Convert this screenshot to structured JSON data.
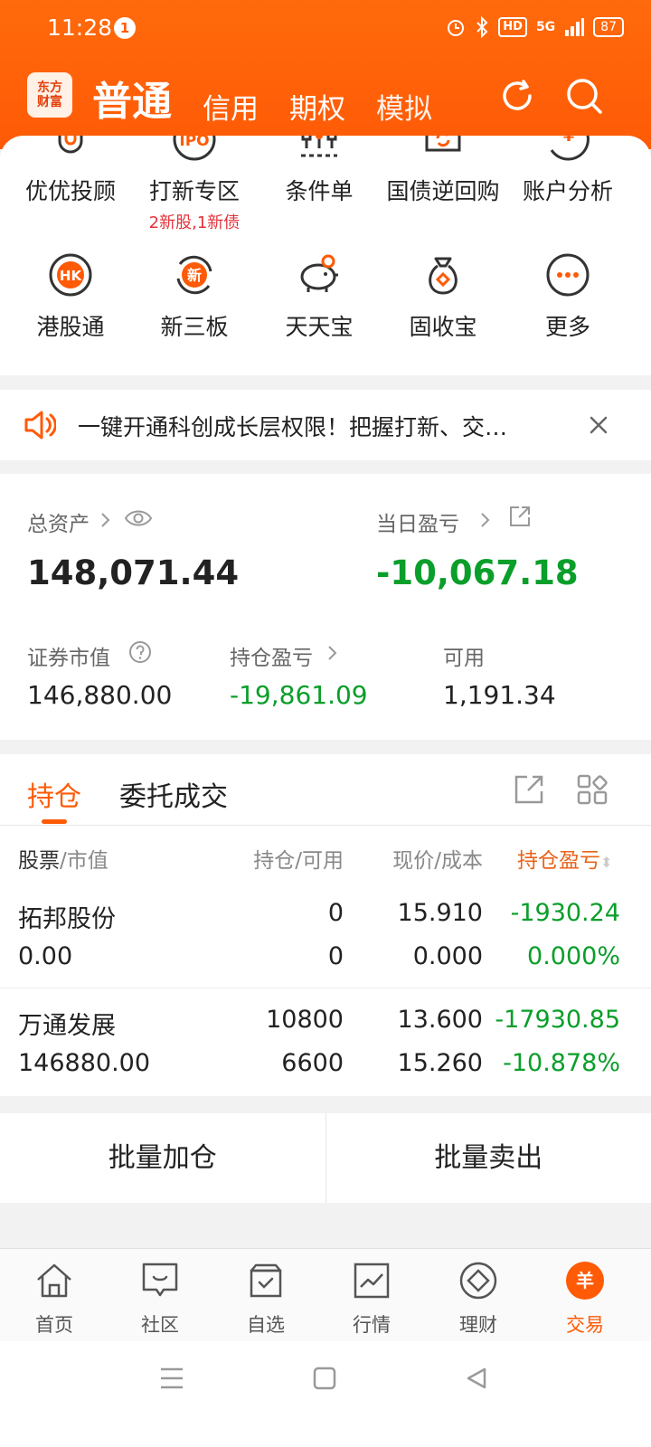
{
  "status_bar": {
    "time": "11:28",
    "notification_count": "1",
    "hd": "HD",
    "network": "5G",
    "battery": "87"
  },
  "header": {
    "logo_line1": "东方",
    "logo_line2": "财富",
    "tabs": [
      {
        "label": "普通",
        "active": true
      },
      {
        "label": "信用",
        "active": false
      },
      {
        "label": "期权",
        "active": false
      },
      {
        "label": "模拟",
        "active": false
      }
    ]
  },
  "quick_grid": [
    {
      "label": "优优投顾",
      "icon": "clip-icon"
    },
    {
      "label": "打新专区",
      "sub": "2新股,1新债",
      "icon": "ipo-icon",
      "icon_text": "IPO"
    },
    {
      "label": "条件单",
      "icon": "condition-order-icon"
    },
    {
      "label": "国债逆回购",
      "icon": "bond-repo-icon"
    },
    {
      "label": "账户分析",
      "icon": "account-analysis-icon",
      "icon_text": "¥"
    },
    {
      "label": "港股通",
      "icon": "hk-icon",
      "icon_text": "HK"
    },
    {
      "label": "新三板",
      "icon": "neeq-icon",
      "icon_text": "新"
    },
    {
      "label": "天天宝",
      "icon": "piggy-bank-icon"
    },
    {
      "label": "固收宝",
      "icon": "money-bag-icon"
    },
    {
      "label": "更多",
      "icon": "more-icon"
    }
  ],
  "banner": {
    "text": "一键开通科创成长层权限！把握打新、交…"
  },
  "assets": {
    "total_label": "总资产",
    "total_value": "148,071.44",
    "daily_pl_label": "当日盈亏",
    "daily_pl_value": "-10,067.18",
    "market_value_label": "证券市值",
    "market_value": "146,880.00",
    "position_pl_label": "持仓盈亏",
    "position_pl_value": "-19,861.09",
    "available_label": "可用",
    "available_value": "1,191.34"
  },
  "holdings": {
    "tabs": [
      "持仓",
      "委托成交"
    ],
    "headers": {
      "stock": "股票",
      "market_value": "/市值",
      "position": "持仓/可用",
      "price": "现价/成本",
      "pl": "持仓盈亏"
    },
    "rows": [
      {
        "name": "拓邦股份",
        "market_value": "0.00",
        "position": "0",
        "available": "0",
        "price": "15.910",
        "cost": "0.000",
        "pl": "-1930.24",
        "pl_pct": "0.000%"
      },
      {
        "name": "万通发展",
        "market_value": "146880.00",
        "position": "10800",
        "available": "6600",
        "price": "13.600",
        "cost": "15.260",
        "pl": "-17930.85",
        "pl_pct": "-10.878%"
      }
    ]
  },
  "batch": {
    "add": "批量加仓",
    "sell": "批量卖出"
  },
  "bottom_nav": [
    {
      "label": "首页",
      "icon": "home-icon"
    },
    {
      "label": "社区",
      "icon": "community-icon"
    },
    {
      "label": "自选",
      "icon": "watchlist-icon"
    },
    {
      "label": "行情",
      "icon": "market-icon"
    },
    {
      "label": "理财",
      "icon": "wealth-icon"
    },
    {
      "label": "交易",
      "icon": "trade-icon",
      "active": true,
      "icon_text": "羊"
    }
  ],
  "colors": {
    "brand": "#ff5a06",
    "loss": "#0a9e2a",
    "highlight": "#e4323a"
  }
}
